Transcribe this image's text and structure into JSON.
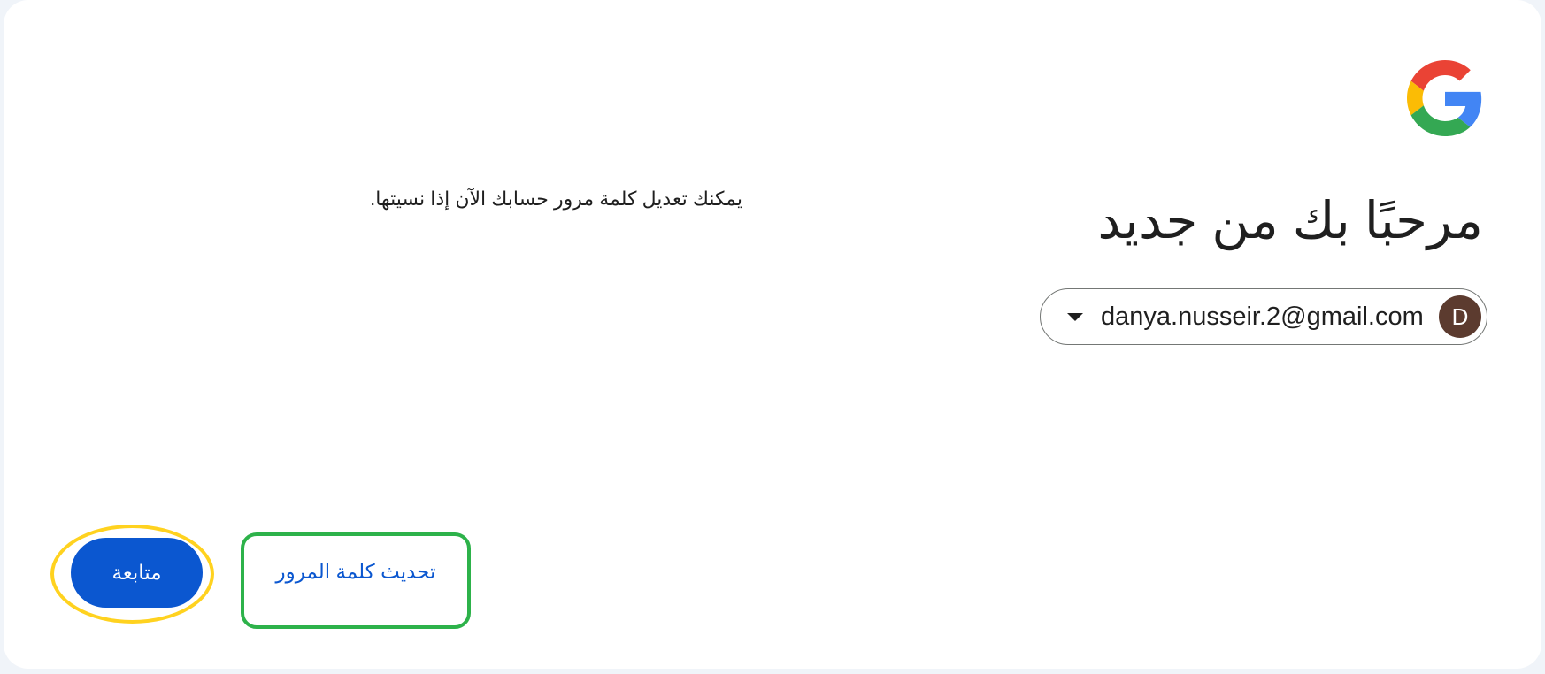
{
  "header": {
    "logo_icon": "google-g-icon",
    "title": "مرحبًا بك من جديد"
  },
  "account": {
    "email": "danya.nusseir.2@gmail.com",
    "avatar_letter": "D",
    "avatar_color": "#5c3b2f",
    "dropdown_icon": "caret-down-icon"
  },
  "main": {
    "description": "يمكنك تعديل كلمة مرور حسابك الآن إذا نسيتها."
  },
  "actions": {
    "continue_label": "متابعة",
    "update_password_label": "تحديث كلمة المرور"
  },
  "colors": {
    "accent": "#0b57d0",
    "continue_highlight": "#ffd21f",
    "update_highlight": "#2db24a"
  }
}
